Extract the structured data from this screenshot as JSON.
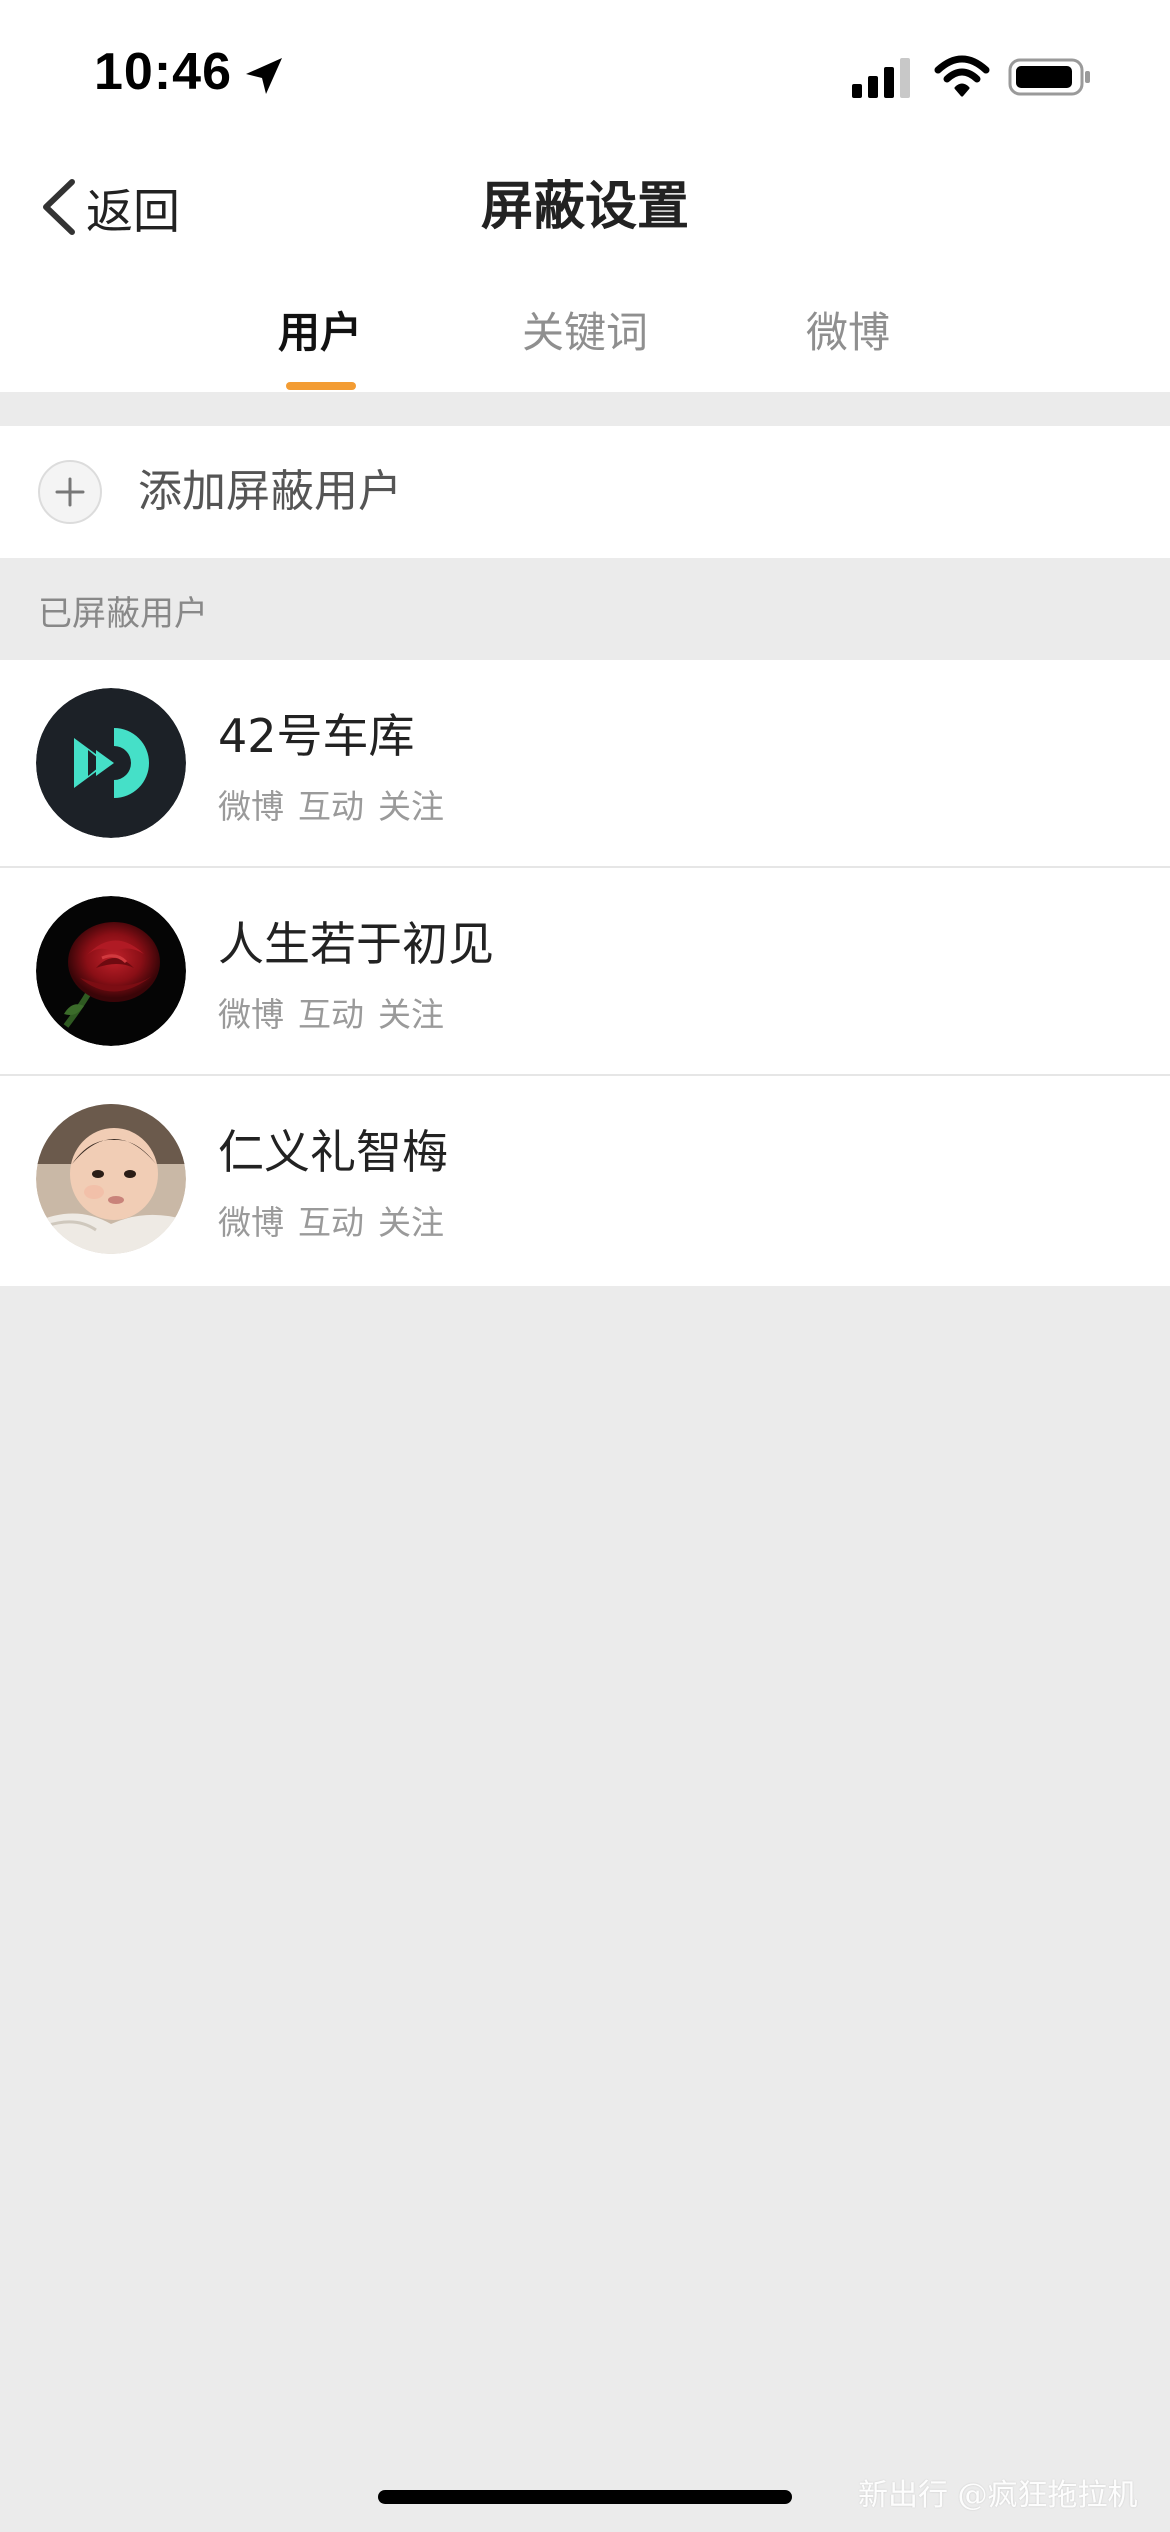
{
  "status_bar": {
    "time": "10:46",
    "icons": [
      "location-arrow-icon",
      "cellular-signal-icon",
      "wifi-icon",
      "battery-icon"
    ]
  },
  "nav": {
    "back_label": "返回",
    "title": "屏蔽设置"
  },
  "tabs": [
    {
      "label": "用户",
      "active": true
    },
    {
      "label": "关键词",
      "active": false
    },
    {
      "label": "微博",
      "active": false
    }
  ],
  "add_row": {
    "label": "添加屏蔽用户",
    "icon": "plus-icon"
  },
  "section": {
    "header": "已屏蔽用户"
  },
  "users": [
    {
      "name": "42号车库",
      "tags": [
        "微博",
        "互动",
        "关注"
      ],
      "avatar": "play-logo-avatar"
    },
    {
      "name": "人生若于初见",
      "tags": [
        "微博",
        "互动",
        "关注"
      ],
      "avatar": "rose-avatar"
    },
    {
      "name": "仁义礼智梅",
      "tags": [
        "微博",
        "互动",
        "关注"
      ],
      "avatar": "baby-photo-avatar"
    }
  ],
  "watermark": "新出行 @疯狂拖拉机",
  "colors": {
    "accent": "#f39c33",
    "background": "#ebebeb",
    "surface": "#ffffff",
    "logo_teal": "#45e0c8"
  }
}
